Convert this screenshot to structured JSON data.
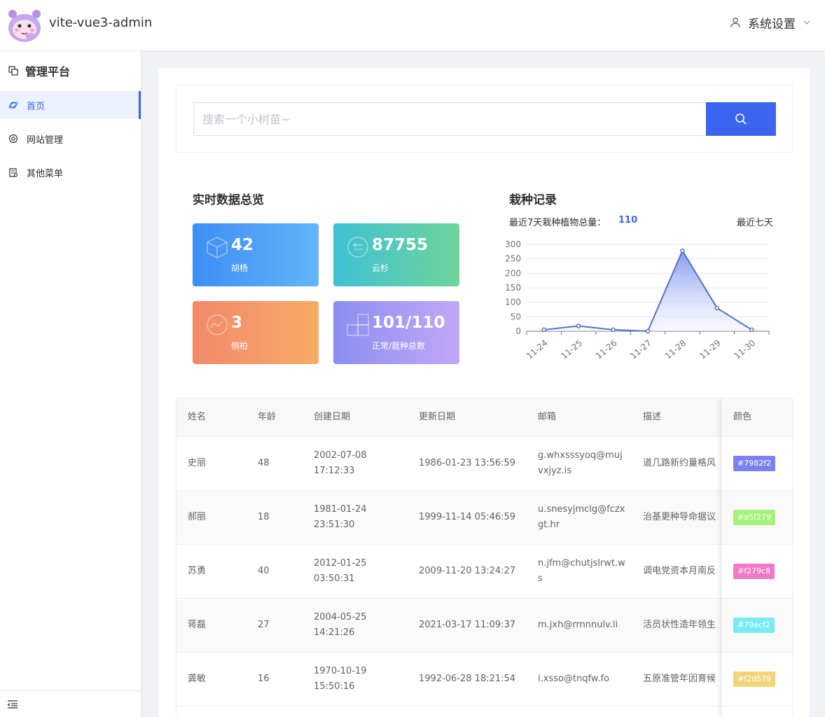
{
  "header": {
    "app_title": "vite-vue3-admin",
    "user_menu_label": "系统设置"
  },
  "sidebar": {
    "brand": "管理平台",
    "items": [
      {
        "label": "首页",
        "active": true
      },
      {
        "label": "网站管理",
        "active": false
      },
      {
        "label": "其他菜单",
        "active": false
      }
    ]
  },
  "search": {
    "placeholder": "搜索一个小树苗~"
  },
  "overview": {
    "title": "实时数据总览",
    "stats": [
      {
        "value": "42",
        "label": "胡杨",
        "icon": "cube-icon"
      },
      {
        "value": "87755",
        "label": "云杉",
        "icon": "arrow-circle-icon"
      },
      {
        "value": "3",
        "label": "侧柏",
        "icon": "trend-circle-icon"
      },
      {
        "value": "101/110",
        "label": "正常/栽种总数",
        "icon": "blocks-icon"
      }
    ]
  },
  "planting": {
    "title": "栽种记录",
    "total_label": "最近7天栽种植物总量：",
    "total_value": "110",
    "range_label": "最近七天"
  },
  "chart_data": {
    "type": "area",
    "categories": [
      "11-24",
      "11-25",
      "11-26",
      "11-27",
      "11-28",
      "11-29",
      "11-30"
    ],
    "values": [
      5,
      18,
      5,
      0,
      278,
      80,
      5
    ],
    "ylim": [
      0,
      300
    ],
    "yticks": [
      0,
      50,
      100,
      150,
      200,
      250,
      300
    ],
    "grid": true,
    "colors": {
      "line": "#5470c6",
      "fill_top": "#6f86f0",
      "fill_bottom": "#eef1fd"
    }
  },
  "table": {
    "columns": [
      "姓名",
      "年龄",
      "创建日期",
      "更新日期",
      "邮箱",
      "描述",
      "颜色"
    ],
    "rows": [
      {
        "name": "史丽",
        "age": "48",
        "created_date": "2002-07-08",
        "created_time": "17:12:33",
        "updated": "1986-01-23 13:56:59",
        "email_1": "g.whxsssyoq@muj",
        "email_2": "vxjyz.is",
        "desc": "道几路新约量格风",
        "color": "#7982f2"
      },
      {
        "name": "郝丽",
        "age": "18",
        "created_date": "1981-01-24",
        "created_time": "23:51:30",
        "updated": "1999-11-14 05:46:59",
        "email_1": "u.snesyjmclg@fczx",
        "email_2": "gt.hr",
        "desc": "治基更种导命据议",
        "color": "#a5f279"
      },
      {
        "name": "苏勇",
        "age": "40",
        "created_date": "2012-01-25",
        "created_time": "03:50:31",
        "updated": "2009-11-20 13:24:27",
        "email_1": "n.jfm@chutjslrwt.w",
        "email_2": "s",
        "desc": "调电党资本月南反",
        "color": "#f279c8"
      },
      {
        "name": "蒋磊",
        "age": "27",
        "created_date": "2004-05-25",
        "created_time": "14:21:26",
        "updated": "2021-03-17 11:09:37",
        "email_1": "m.jxh@rrnnnulv.li",
        "email_2": "",
        "desc": "活员状性造年领生",
        "color": "#79ecf2"
      },
      {
        "name": "龚敏",
        "age": "16",
        "created_date": "1970-10-19",
        "created_time": "15:50:16",
        "updated": "1992-06-28 18:21:54",
        "email_1": "i.xsso@tnqfw.fo",
        "email_2": "",
        "desc": "五原准管年因育候",
        "color": "#f2d579"
      }
    ]
  }
}
